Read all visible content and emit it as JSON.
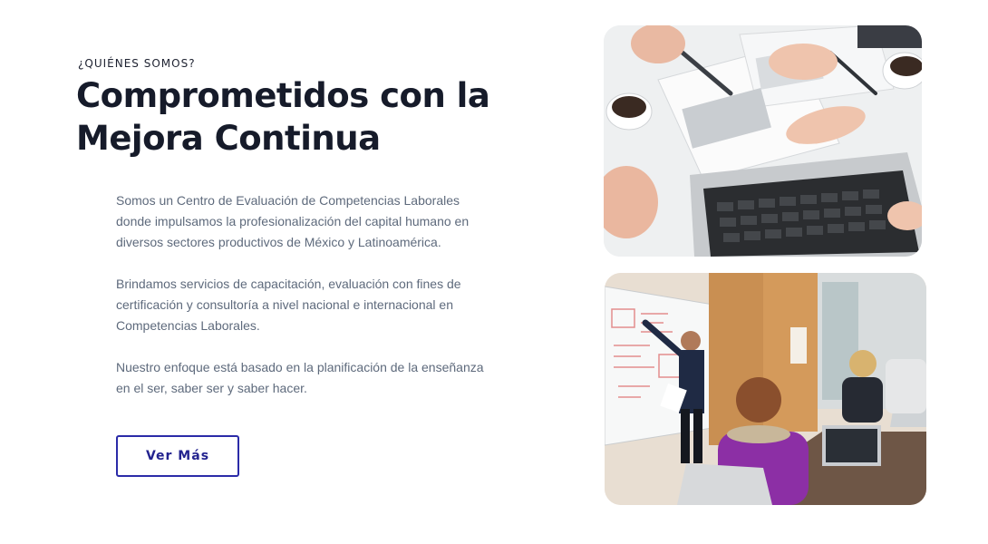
{
  "section": {
    "eyebrow": "¿QUIÉNES SOMOS?",
    "title_line1": "Comprometidos con la",
    "title_line2": "Mejora Continua",
    "paragraphs": [
      "Somos un Centro de Evaluación de Competencias Laborales donde impulsamos la profesionalización del capital humano en diversos sectores productivos de México y Latinoamérica.",
      "Brindamos servicios de capacitación, evaluación con fines de certificación y consultoría a nivel nacional e internacional en Competencias Laborales.",
      "Nuestro enfoque está basado en la planificación de la enseñanza en el ser, saber ser y saber hacer."
    ],
    "button_label": "Ver Más"
  },
  "colors": {
    "heading": "#161b2a",
    "body_text": "#5e6a7c",
    "button_accent": "#2b2ba8"
  }
}
